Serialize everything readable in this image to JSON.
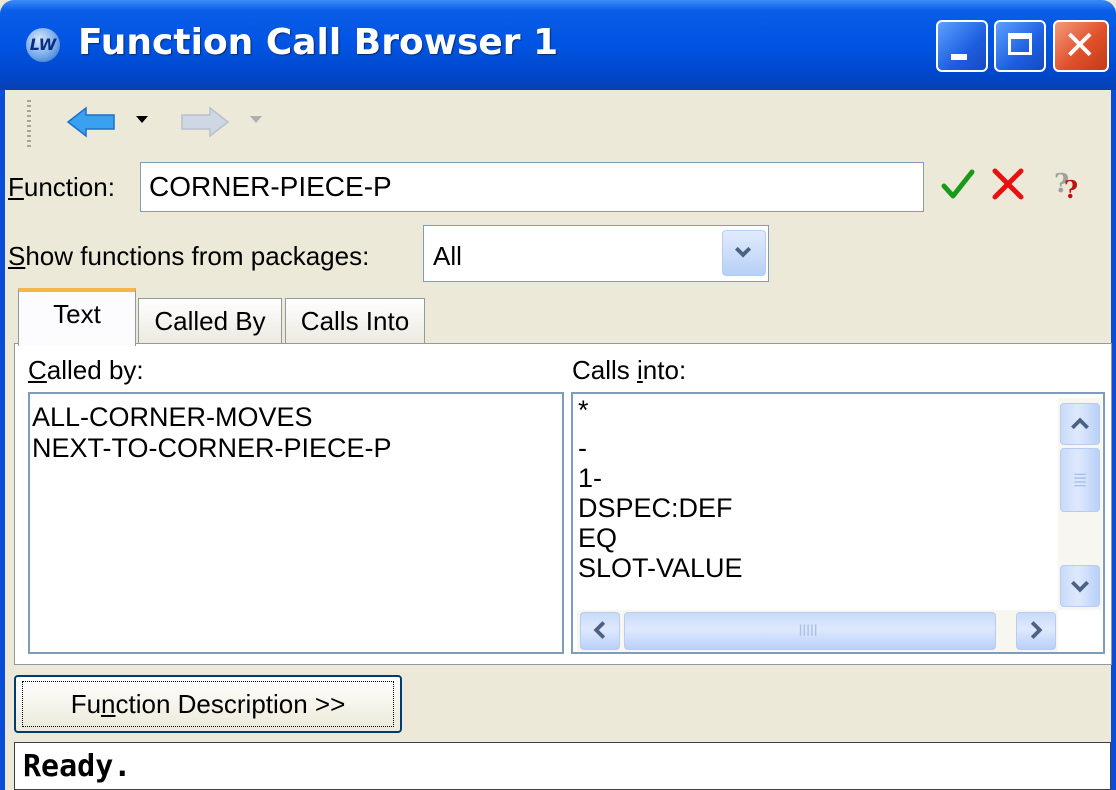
{
  "window": {
    "title": "Function Call Browser 1",
    "app_icon_text": "LW"
  },
  "toolbar": {
    "back_icon": "back-arrow-icon",
    "forward_icon": "forward-arrow-icon"
  },
  "function_row": {
    "label_prefix": "F",
    "label_rest": "unction:",
    "value": "CORNER-PIECE-P",
    "help_glyph": "?"
  },
  "packages_row": {
    "label_prefix": "S",
    "label_rest": "how functions from packages:",
    "selected": "All"
  },
  "tabs": [
    {
      "label": "Text",
      "active": true
    },
    {
      "label": "Called By",
      "active": false
    },
    {
      "label": "Calls Into",
      "active": false
    }
  ],
  "called_by": {
    "label_prefix": "C",
    "label_rest": "alled by:",
    "items": [
      "ALL-CORNER-MOVES",
      "NEXT-TO-CORNER-PIECE-P"
    ]
  },
  "calls_into": {
    "label_a": "Calls ",
    "label_u": "i",
    "label_b": "nto:",
    "items": [
      "*",
      "-",
      "1-",
      "DSPEC:DEF",
      "EQ",
      "SLOT-VALUE"
    ]
  },
  "description_button": {
    "a": "Fu",
    "u": "n",
    "b": "ction Description >>"
  },
  "status": "Ready.",
  "colors": {
    "titlebar": "#0054e3",
    "accept": "#1a9a1a",
    "cancel": "#e81010",
    "tab_highlight": "#f7b64b"
  }
}
